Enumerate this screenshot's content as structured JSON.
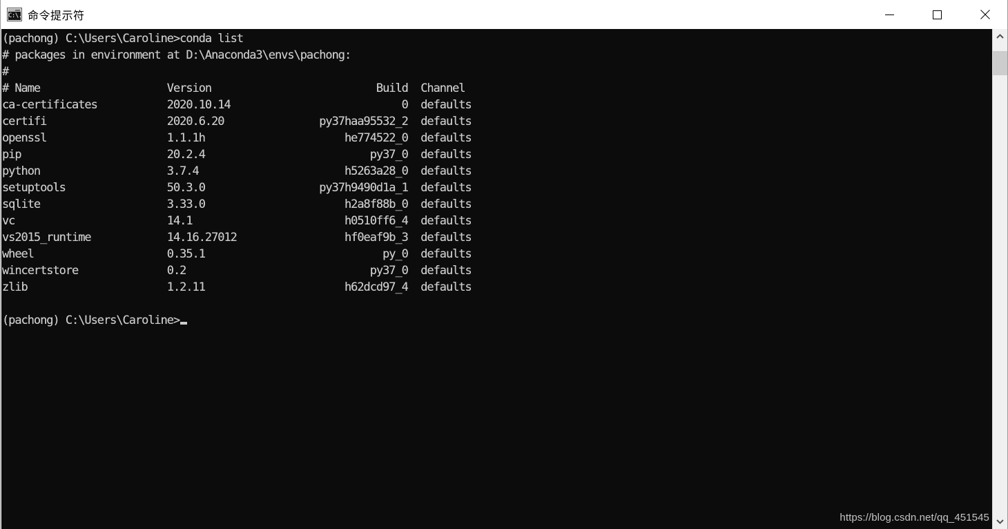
{
  "window": {
    "title": "命令提示符",
    "icon": "command-prompt-icon",
    "icon_text": "C:\\.",
    "background": "#0c0c0c",
    "text_color": "#cccccc"
  },
  "caption_buttons": [
    {
      "name": "minimize-button",
      "label": "Minimize"
    },
    {
      "name": "maximize-button",
      "label": "Maximize"
    },
    {
      "name": "close-button",
      "label": "Close"
    }
  ],
  "console": {
    "prompt_line": "(pachong) C:\\Users\\Caroline>conda list",
    "header_lines": [
      "# packages in environment at D:\\Anaconda3\\envs\\pachong:",
      "#"
    ],
    "columns": {
      "name": "# Name",
      "version": "Version",
      "build": "Build",
      "channel": "Channel"
    },
    "packages": [
      {
        "name": "ca-certificates",
        "version": "2020.10.14",
        "build": "0",
        "channel": "defaults"
      },
      {
        "name": "certifi",
        "version": "2020.6.20",
        "build": "py37haa95532_2",
        "channel": "defaults"
      },
      {
        "name": "openssl",
        "version": "1.1.1h",
        "build": "he774522_0",
        "channel": "defaults"
      },
      {
        "name": "pip",
        "version": "20.2.4",
        "build": "py37_0",
        "channel": "defaults"
      },
      {
        "name": "python",
        "version": "3.7.4",
        "build": "h5263a28_0",
        "channel": "defaults"
      },
      {
        "name": "setuptools",
        "version": "50.3.0",
        "build": "py37h9490d1a_1",
        "channel": "defaults"
      },
      {
        "name": "sqlite",
        "version": "3.33.0",
        "build": "h2a8f88b_0",
        "channel": "defaults"
      },
      {
        "name": "vc",
        "version": "14.1",
        "build": "h0510ff6_4",
        "channel": "defaults"
      },
      {
        "name": "vs2015_runtime",
        "version": "14.16.27012",
        "build": "hf0eaf9b_3",
        "channel": "defaults"
      },
      {
        "name": "wheel",
        "version": "0.35.1",
        "build": "py_0",
        "channel": "defaults"
      },
      {
        "name": "wincertstore",
        "version": "0.2",
        "build": "py37_0",
        "channel": "defaults"
      },
      {
        "name": "zlib",
        "version": "1.2.11",
        "build": "h62dcd97_4",
        "channel": "defaults"
      }
    ],
    "final_prompt": "(pachong) C:\\Users\\Caroline>"
  },
  "watermark": "https://blog.csdn.net/qq_451545",
  "scrollbar": {
    "up_arrow": "chevron-up-icon",
    "down_arrow": "chevron-down-icon"
  }
}
